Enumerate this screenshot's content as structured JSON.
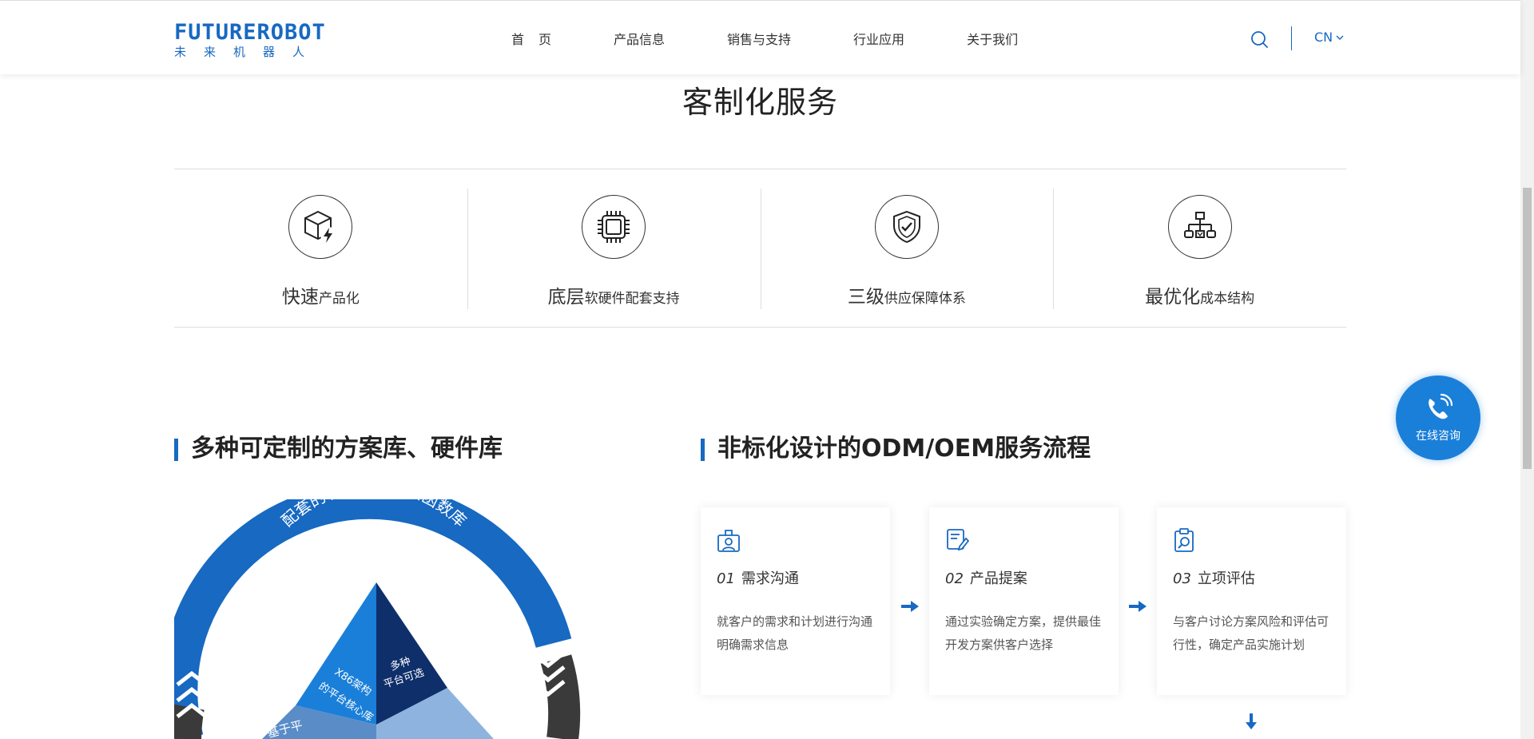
{
  "header": {
    "logo_en": "FUTUREROBOT",
    "logo_cn": "未来机器人",
    "nav": [
      "首页",
      "产品信息",
      "销售与支持",
      "行业应用",
      "关于我们"
    ],
    "lang": "CN"
  },
  "section": {
    "title": "客制化服务"
  },
  "features": [
    {
      "big": "快速",
      "small": "产品化",
      "icon": "cube-lightning-icon"
    },
    {
      "big": "底层",
      "small": "软硬件配套支持",
      "icon": "chip-icon"
    },
    {
      "big": "三级",
      "small": "供应保障体系",
      "icon": "shield-check-icon"
    },
    {
      "big": "最优化",
      "small": "成本结构",
      "icon": "org-chart-icon"
    }
  ],
  "left_section": {
    "title": "多种可定制的方案库、硬件库",
    "ring_text": "配套的软件、驱动和函数库",
    "pyramid_left": [
      "X86架构",
      "的平台核心库"
    ],
    "pyramid_right": [
      "多种",
      "平台可选"
    ],
    "pyramid_bottom": "基于平"
  },
  "right_section": {
    "title": "非标化设计的ODM/OEM服务流程",
    "steps": [
      {
        "num": "01",
        "title": "需求沟通",
        "desc": "就客户的需求和计划进行沟通明确需求信息",
        "icon": "user-badge-icon"
      },
      {
        "num": "02",
        "title": "产品提案",
        "desc": "通过实验确定方案，提供最佳开发方案供客户选择",
        "icon": "document-edit-icon"
      },
      {
        "num": "03",
        "title": "立项评估",
        "desc": "与客户讨论方案风险和评估可行性，确定产品实施计划",
        "icon": "clipboard-search-icon"
      }
    ]
  },
  "consult": {
    "label": "在线咨询"
  },
  "colors": {
    "accent": "#1769c2",
    "consult_bg": "#1a7fd9"
  }
}
